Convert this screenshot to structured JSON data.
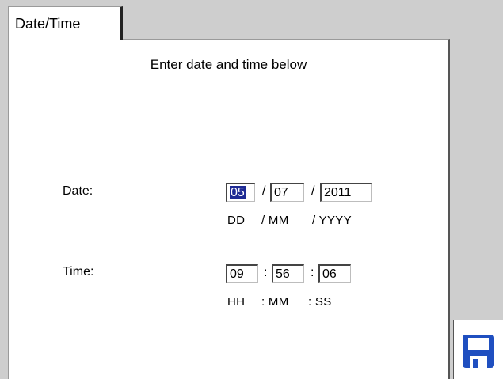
{
  "tab": {
    "label": "Date/Time"
  },
  "heading": "Enter date and time below",
  "date": {
    "label": "Date:",
    "day": "05",
    "month": "07",
    "year": "2011",
    "separator": "/",
    "format_dd": "DD",
    "format_mm": "/ MM",
    "format_yyyy": "/ YYYY"
  },
  "time": {
    "label": "Time:",
    "hours": "09",
    "minutes": "56",
    "seconds": "06",
    "separator": ":",
    "format_hh": "HH",
    "format_mm": ": MM",
    "format_ss": ": SS"
  },
  "save_button": {
    "icon": "floppy-disk-icon",
    "color": "#1f4fc0"
  }
}
